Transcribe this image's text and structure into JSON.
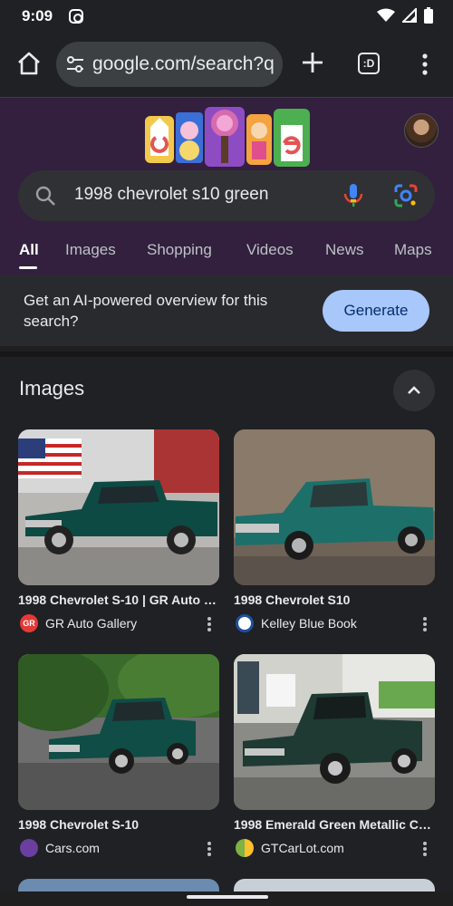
{
  "status": {
    "time": "9:09"
  },
  "browser": {
    "url": "google.com/search?q",
    "tab_switcher_label": ":D"
  },
  "search": {
    "query": "1998 chevrolet s10 green"
  },
  "tabs": [
    {
      "label": "All",
      "active": true
    },
    {
      "label": "Images"
    },
    {
      "label": "Shopping"
    },
    {
      "label": "Videos"
    },
    {
      "label": "News"
    },
    {
      "label": "Maps"
    }
  ],
  "ai_overview": {
    "text": "Get an AI-powered overview for this search?",
    "button": "Generate"
  },
  "images": {
    "title": "Images",
    "results": [
      {
        "title": "1998 Chevrolet S-10 | GR Auto Gallery",
        "source": "GR Auto Gallery",
        "fav_color": "#e53935",
        "fav_letter": "GR"
      },
      {
        "title": "1998 Chevrolet S10",
        "source": "Kelley Blue Book",
        "fav_color": "#1e4fa1",
        "fav_letter": ""
      },
      {
        "title": "1998 Chevrolet S-10",
        "source": "Cars.com",
        "fav_color": "#6b3fa0",
        "fav_letter": ""
      },
      {
        "title": "1998 Emerald Green Metallic Chevrolet S-10",
        "source": "GTCarLot.com",
        "fav_color": "#7cb342",
        "fav_letter": ""
      }
    ]
  },
  "colors": {
    "background": "#202124",
    "header": "#32203e",
    "accent": "#a8c7fa"
  }
}
